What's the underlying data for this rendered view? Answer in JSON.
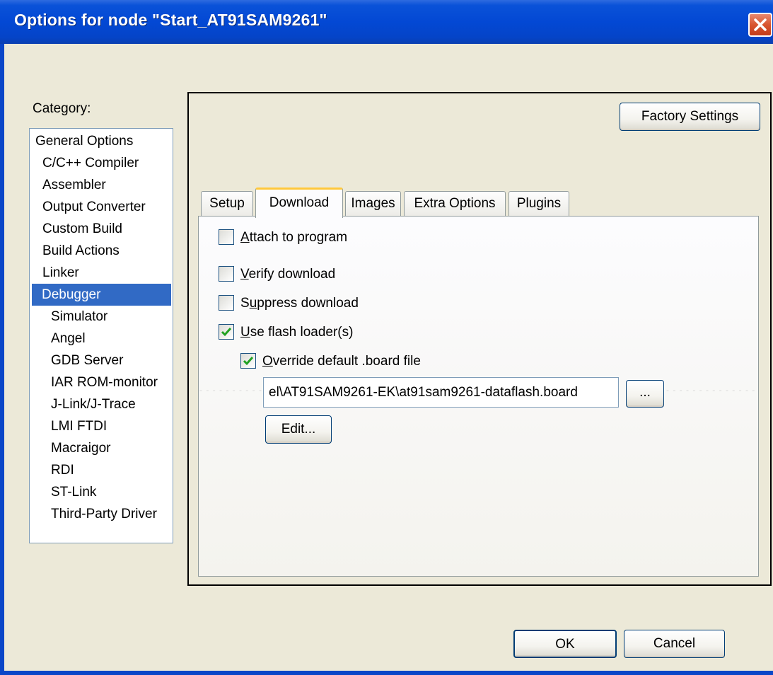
{
  "window": {
    "title": "Options for node \"Start_AT91SAM9261\"",
    "close_icon": "close-icon"
  },
  "category": {
    "label": "Category:",
    "items": [
      {
        "label": "General Options",
        "level": 0,
        "selected": false
      },
      {
        "label": "C/C++ Compiler",
        "level": 1,
        "selected": false
      },
      {
        "label": "Assembler",
        "level": 1,
        "selected": false
      },
      {
        "label": "Output Converter",
        "level": 1,
        "selected": false
      },
      {
        "label": "Custom Build",
        "level": 1,
        "selected": false
      },
      {
        "label": "Build Actions",
        "level": 1,
        "selected": false
      },
      {
        "label": "Linker",
        "level": 1,
        "selected": false
      },
      {
        "label": "Debugger",
        "level": 1,
        "selected": true
      },
      {
        "label": "Simulator",
        "level": 2,
        "selected": false
      },
      {
        "label": "Angel",
        "level": 2,
        "selected": false
      },
      {
        "label": "GDB Server",
        "level": 2,
        "selected": false
      },
      {
        "label": "IAR ROM-monitor",
        "level": 2,
        "selected": false
      },
      {
        "label": "J-Link/J-Trace",
        "level": 2,
        "selected": false
      },
      {
        "label": "LMI FTDI",
        "level": 2,
        "selected": false
      },
      {
        "label": "Macraigor",
        "level": 2,
        "selected": false
      },
      {
        "label": "RDI",
        "level": 2,
        "selected": false
      },
      {
        "label": "ST-Link",
        "level": 2,
        "selected": false
      },
      {
        "label": "Third-Party Driver",
        "level": 2,
        "selected": false
      }
    ]
  },
  "panel": {
    "factory_settings_label": "Factory Settings",
    "tabs": [
      {
        "label": "Setup",
        "active": false
      },
      {
        "label": "Download",
        "active": true
      },
      {
        "label": "Images",
        "active": false
      },
      {
        "label": "Extra Options",
        "active": false
      },
      {
        "label": "Plugins",
        "active": false
      }
    ],
    "download": {
      "attach": {
        "mnemonic": "A",
        "rest": "ttach to program",
        "checked": false
      },
      "verify": {
        "mnemonic": "V",
        "rest": "erify download",
        "checked": false
      },
      "suppress": {
        "pre": "S",
        "mnemonic": "u",
        "rest": "ppress download",
        "checked": false
      },
      "flash_loader": {
        "mnemonic": "U",
        "rest": "se flash loader(s)",
        "checked": true
      },
      "override": {
        "mnemonic": "O",
        "rest": "verride default .board file",
        "checked": true
      },
      "board_path": "el\\AT91SAM9261-EK\\at91sam9261-dataflash.board",
      "browse_label": "...",
      "edit_label": "Edit..."
    }
  },
  "footer": {
    "ok_label": "OK",
    "cancel_label": "Cancel"
  },
  "colors": {
    "title_bar": "#0348d4",
    "selection": "#316ac5",
    "check_mark": "#21a121",
    "active_tab_accent": "#ffc83c"
  }
}
